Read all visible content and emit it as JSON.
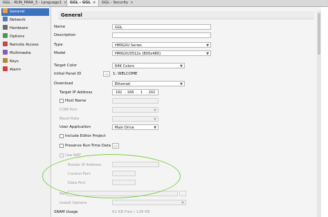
{
  "tabs": [
    {
      "label": "GGL - RUN_PARA_3 - Language1",
      "active": false
    },
    {
      "label": "GGL - GGL",
      "active": true
    },
    {
      "label": "GGL - Security",
      "active": false
    }
  ],
  "sidebar": {
    "items": [
      {
        "label": "General",
        "active": true,
        "color": "#e8a33d"
      },
      {
        "label": "Network",
        "active": false,
        "color": "#4a7bc8"
      },
      {
        "label": "Hardware",
        "active": false,
        "color": "#6a6a6a"
      },
      {
        "label": "Options",
        "active": false,
        "color": "#4a9a4a"
      },
      {
        "label": "Remote Access",
        "active": false,
        "color": "#c04a4a"
      },
      {
        "label": "Multimedia",
        "active": false,
        "color": "#8a5ab8"
      },
      {
        "label": "Keys",
        "active": false,
        "color": "#b08a3a"
      },
      {
        "label": "Alarm",
        "active": false,
        "color": "#d04040"
      }
    ]
  },
  "header": {
    "title": "General"
  },
  "form": {
    "name": {
      "label": "Name",
      "value": "GGL"
    },
    "description": {
      "label": "Description",
      "value": ""
    },
    "type": {
      "label": "Type",
      "value": "HMIGXU Series"
    },
    "model": {
      "label": "Model",
      "value": "HMIGXU3512x (800x480)"
    },
    "target_color": {
      "label": "Target Color",
      "value": "64K Colors"
    },
    "initial_panel": {
      "label": "Initial Panel ID",
      "button": "...",
      "value": "1: WELCOME"
    },
    "download": {
      "label": "Download",
      "value": "Ethernet"
    },
    "target_ip": {
      "label": "Target IP Address",
      "octets": [
        "192",
        "168",
        "1",
        "202"
      ]
    },
    "host_name": {
      "label": "Host Name",
      "value": ""
    },
    "com_port": {
      "label": "COM Port",
      "value": ""
    },
    "baud_rate": {
      "label": "Baud Rate",
      "value": ""
    },
    "user_application": {
      "label": "User Application",
      "value": "Main Drive"
    },
    "include_editor": {
      "label": "Include Editor Project"
    },
    "preserve_runtime": {
      "label": "Preserve Run-Time Data",
      "button": "..."
    },
    "use_nat": {
      "label": "Use NAT"
    },
    "router_ip": {
      "label": "Router IP Address",
      "value": ""
    },
    "control_port": {
      "label": "Control Port",
      "value": ""
    },
    "data_port": {
      "label": "Data Port",
      "value": ""
    },
    "path": {
      "label": "Path",
      "value": "",
      "button": "..."
    },
    "install_options": {
      "label": "Install Options",
      "value": ""
    },
    "sram_usage": {
      "label": "SRAM Usage",
      "value": "61 KB Free / 128 KB"
    }
  },
  "colors": {
    "accent": "#3c73c0",
    "annotation": "#7ccf3e"
  }
}
